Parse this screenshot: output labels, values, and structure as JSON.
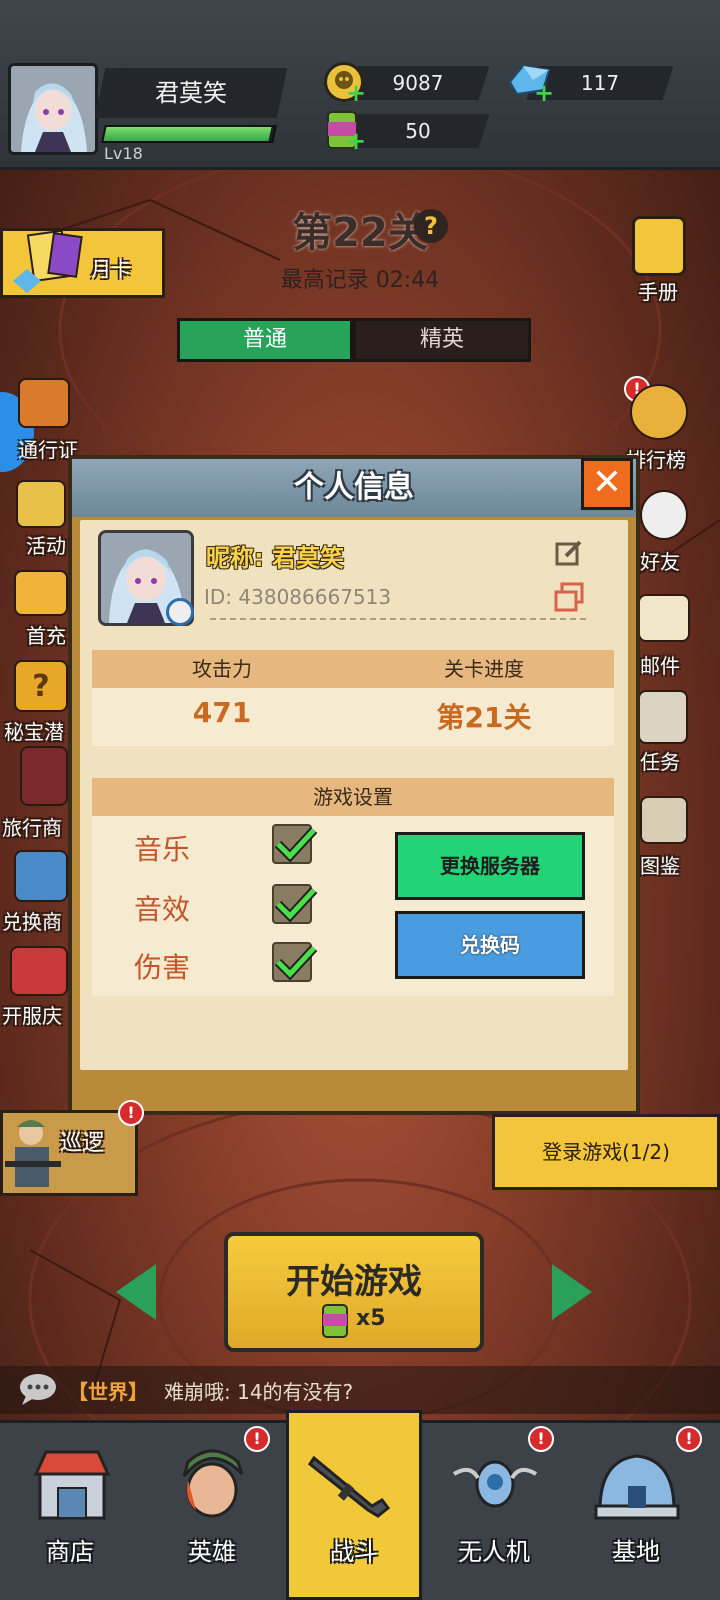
{
  "player": {
    "name": "君莫笑",
    "level": "Lv18",
    "xp_fraction": 0.98
  },
  "resources": {
    "coins": "9087",
    "gems": "117",
    "energy": "50"
  },
  "stage": {
    "title": "第22关",
    "help": "?",
    "best_record": "最高记录 02:44",
    "tabs": [
      {
        "label": "普通",
        "active": true
      },
      {
        "label": "精英",
        "active": false
      }
    ]
  },
  "left_menu": {
    "monthly_card": "月卡",
    "pass": "通行证",
    "events": "活动",
    "first_recharge": "首充",
    "treasure": "秘宝潜",
    "travel_merchant": "旅行商",
    "exchange_shop": "兑换商",
    "anniversary": "开服庆"
  },
  "right_menu": {
    "manual": "手册",
    "leaderboard": "排行榜",
    "friends": "好友",
    "mail": "邮件",
    "tasks": "任务",
    "codex": "图鉴"
  },
  "modal": {
    "title": "个人信息",
    "close": "✕",
    "nickname": "昵称: 君莫笑",
    "player_id": "ID: 438086667513",
    "stats_headers": [
      "攻击力",
      "关卡进度"
    ],
    "attack": "471",
    "progress": "第21关",
    "settings_header": "游戏设置",
    "settings": [
      {
        "label": "音乐",
        "checked": true
      },
      {
        "label": "音效",
        "checked": true
      },
      {
        "label": "伤害",
        "checked": true
      }
    ],
    "btn_change_server": "更换服务器",
    "btn_redeem_code": "兑换码"
  },
  "lower": {
    "patrol": "巡逻",
    "login_quest": "登录游戏(1/2)",
    "start_game": "开始游戏",
    "start_cost": "x5",
    "chat_channel": "【世界】",
    "chat_message": "难崩哦: 14的有没有?"
  },
  "bottom_nav": [
    {
      "label": "商店",
      "icon": "shop-icon",
      "badge": false
    },
    {
      "label": "英雄",
      "icon": "hero-icon",
      "badge": true
    },
    {
      "label": "战斗",
      "icon": "rifle-icon",
      "badge": false,
      "active": true
    },
    {
      "label": "无人机",
      "icon": "drone-icon",
      "badge": true
    },
    {
      "label": "基地",
      "icon": "base-icon",
      "badge": true
    }
  ],
  "colors": {
    "accent_green": "#27a35a",
    "gold": "#f3c53a",
    "orange_close": "#ef6b1e",
    "blue_button": "#4a9ce0"
  }
}
